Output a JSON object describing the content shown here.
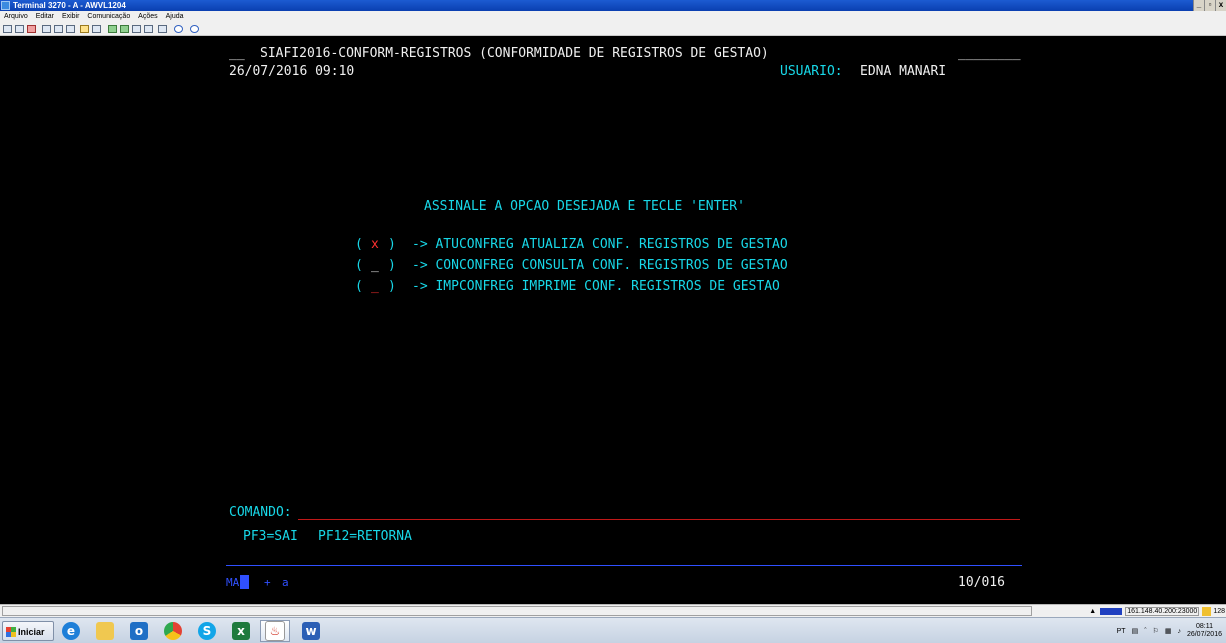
{
  "window": {
    "title": "Terminal 3270 - A - AWVL1204",
    "minimize": "_",
    "maximize": "▫",
    "close": "x"
  },
  "menu": [
    "Arquivo",
    "Editar",
    "Exibir",
    "Comunicação",
    "Ações",
    "Ajuda"
  ],
  "screen": {
    "title_prefix": "__",
    "title": "SIAFI2016-CONFORM-REGISTROS (CONFORMIDADE DE REGISTROS DE GESTAO)",
    "title_suffix": "________",
    "datetime": "26/07/2016 09:10",
    "user_label": "USUARIO:",
    "user_name": "EDNA MANARI",
    "instruction": "ASSINALE A OPCAO DESEJADA E TECLE 'ENTER'",
    "options": [
      {
        "open": "(",
        "mark": "x",
        "close": ")",
        "text": "-> ATUCONFREG ATUALIZA CONF. REGISTROS DE GESTAO"
      },
      {
        "open": "(",
        "mark": "_",
        "close": ")",
        "text": "-> CONCONFREG CONSULTA CONF. REGISTROS DE GESTAO"
      },
      {
        "open": "(",
        "mark": "_",
        "close": ")",
        "text": "-> IMPCONFREG IMPRIME CONF. REGISTROS DE GESTAO"
      }
    ],
    "command_label": "COMANDO:",
    "command_value": "",
    "pf_keys": [
      "PF3=SAI",
      "PF12=RETORNA"
    ]
  },
  "oia": {
    "mode": "MA",
    "plus": "+",
    "indicator": "a",
    "cursor_pos": "10/016"
  },
  "status": {
    "host": "161.148.40.200:23000",
    "session": "128"
  },
  "taskbar": {
    "start_label": "Iniciar",
    "apps": [
      "internet-explorer-icon",
      "file-explorer-icon",
      "outlook-icon",
      "chrome-icon",
      "skype-icon",
      "excel-icon",
      "java-icon",
      "word-icon"
    ],
    "tray_lang": "PT",
    "clock_time": "08:11",
    "clock_date": "26/07/2016"
  },
  "colors": {
    "cyan": "#18d8e8",
    "red": "#ff3030",
    "white": "#f0f0f0",
    "blue_line": "#3050ff",
    "red_line": "#c01818"
  }
}
